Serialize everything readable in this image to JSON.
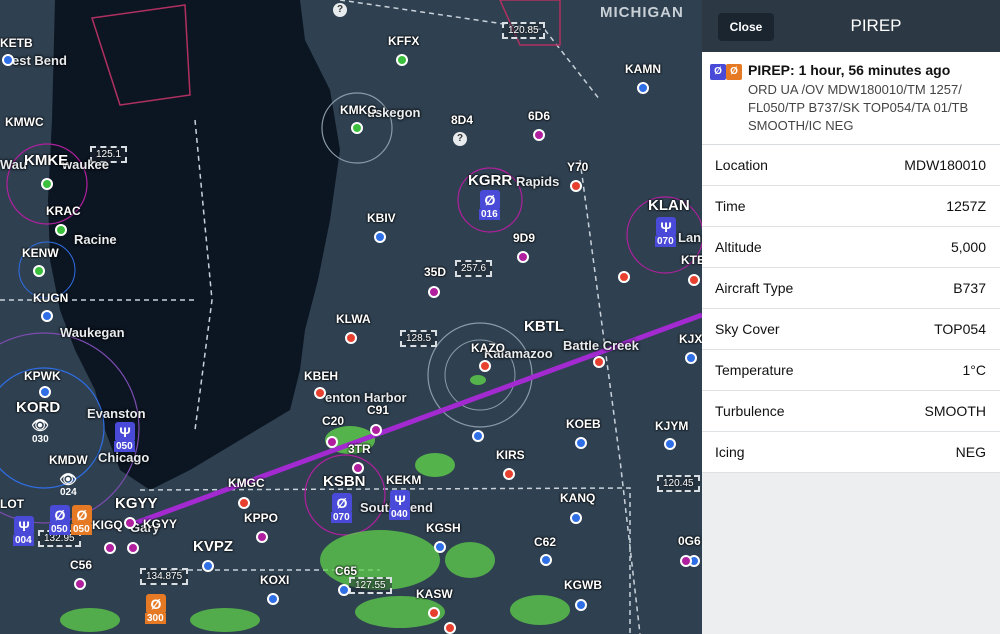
{
  "panel": {
    "close_label": "Close",
    "title": "PIREP",
    "summary": {
      "title": "PIREP: 1 hour, 56 minutes ago",
      "body": "ORD UA /OV MDW180010/TM 1257/ FL050/TP B737/SK TOP054/TA 01/TB SMOOTH/IC NEG",
      "icon_left": "Ø",
      "icon_right": "Ø",
      "icon_left_color": "#4a4ad8",
      "icon_right_color": "#e67a24"
    },
    "rows": [
      {
        "label": "Location",
        "value": "MDW180010"
      },
      {
        "label": "Time",
        "value": "1257Z"
      },
      {
        "label": "Altitude",
        "value": "5,000"
      },
      {
        "label": "Aircraft Type",
        "value": "B737"
      },
      {
        "label": "Sky Cover",
        "value": "TOP054"
      },
      {
        "label": "Temperature",
        "value": "1°C"
      },
      {
        "label": "Turbulence",
        "value": "SMOOTH"
      },
      {
        "label": "Icing",
        "value": "NEG"
      }
    ]
  },
  "map": {
    "state_label": "MICHIGAN",
    "airports": {
      "ketb": "KETB",
      "kffx": "KFFX",
      "kamn": "KAMN",
      "kmwc": "KMWC",
      "kmke": "KMKE",
      "kmkg": "KMKG",
      "8d4": "8D4",
      "6d6": "6D6",
      "krac": "KRAC",
      "kgrr": "KGRR",
      "y70": "Y70",
      "kenw": "KENW",
      "kbiv": "KBIV",
      "klan": "KLAN",
      "9d9": "9D9",
      "35d": "35D",
      "kugn": "KUGN",
      "klwa": "KLWA",
      "kbtl": "KBTL",
      "kazo": "KAZO",
      "kpwk": "KPWK",
      "kbeh": "KBEH",
      "kord": "KORD",
      "c20": "C20",
      "c91": "C91",
      "koeb": "KOEB",
      "kjym": "KJYM",
      "kmdw": "KMDW",
      "kirs": "KIRS",
      "3tr": "3TR",
      "kgyy": "KGYY",
      "kmgc": "KMGC",
      "ksbn": "KSBN",
      "kekm": "KEKM",
      "kanq": "KANQ",
      "kppo": "KPPO",
      "kgsh": "KGSH",
      "kigq": "KIGQ",
      "kvpz": "KVPZ",
      "c62": "C62",
      "c56": "C56",
      "c65": "C65",
      "koxi": "KOXI",
      "kgwb": "KGWB",
      "kasw": "KASW",
      "0g6": "0G6",
      "lot": "LOT",
      "kte": "KTE",
      "kjx": "KJX"
    },
    "cities": {
      "west_bend": "est Bend",
      "muskegon": "uskegon",
      "waukesha": "Wau",
      "milwaukee": "waukee",
      "racine": "Racine",
      "grand_rapids": "Rapids",
      "lansing": "Lan",
      "waukegan": "Waukegan",
      "kalamazoo": "Kalamazoo",
      "battle_creek": "Battle Creek",
      "benton_harbor": "enton Harbor",
      "evanston": "Evanston",
      "chicago": "Chicago",
      "south_bend": "South Bend",
      "gary": "Gary"
    },
    "freqs": {
      "f1": "120.85",
      "f2": "125.1",
      "f3": "257.6",
      "f4": "128.5",
      "f5": "120.45",
      "f6": "134.875",
      "f7": "127.55",
      "f8": "132.95"
    },
    "pireps": {
      "p016": "016",
      "p070a": "070",
      "p050a": "050",
      "p030": "030",
      "p024": "024",
      "p050b": "050",
      "p050c": "050",
      "p004": "004",
      "p070b": "070",
      "p040": "040",
      "p300": "300"
    },
    "colors": {
      "water": "#0c1522",
      "land": "#2f4050",
      "route": "#a22ad0",
      "pirep_blue": "#4a4ad8",
      "pirep_orange": "#e67a24"
    }
  }
}
